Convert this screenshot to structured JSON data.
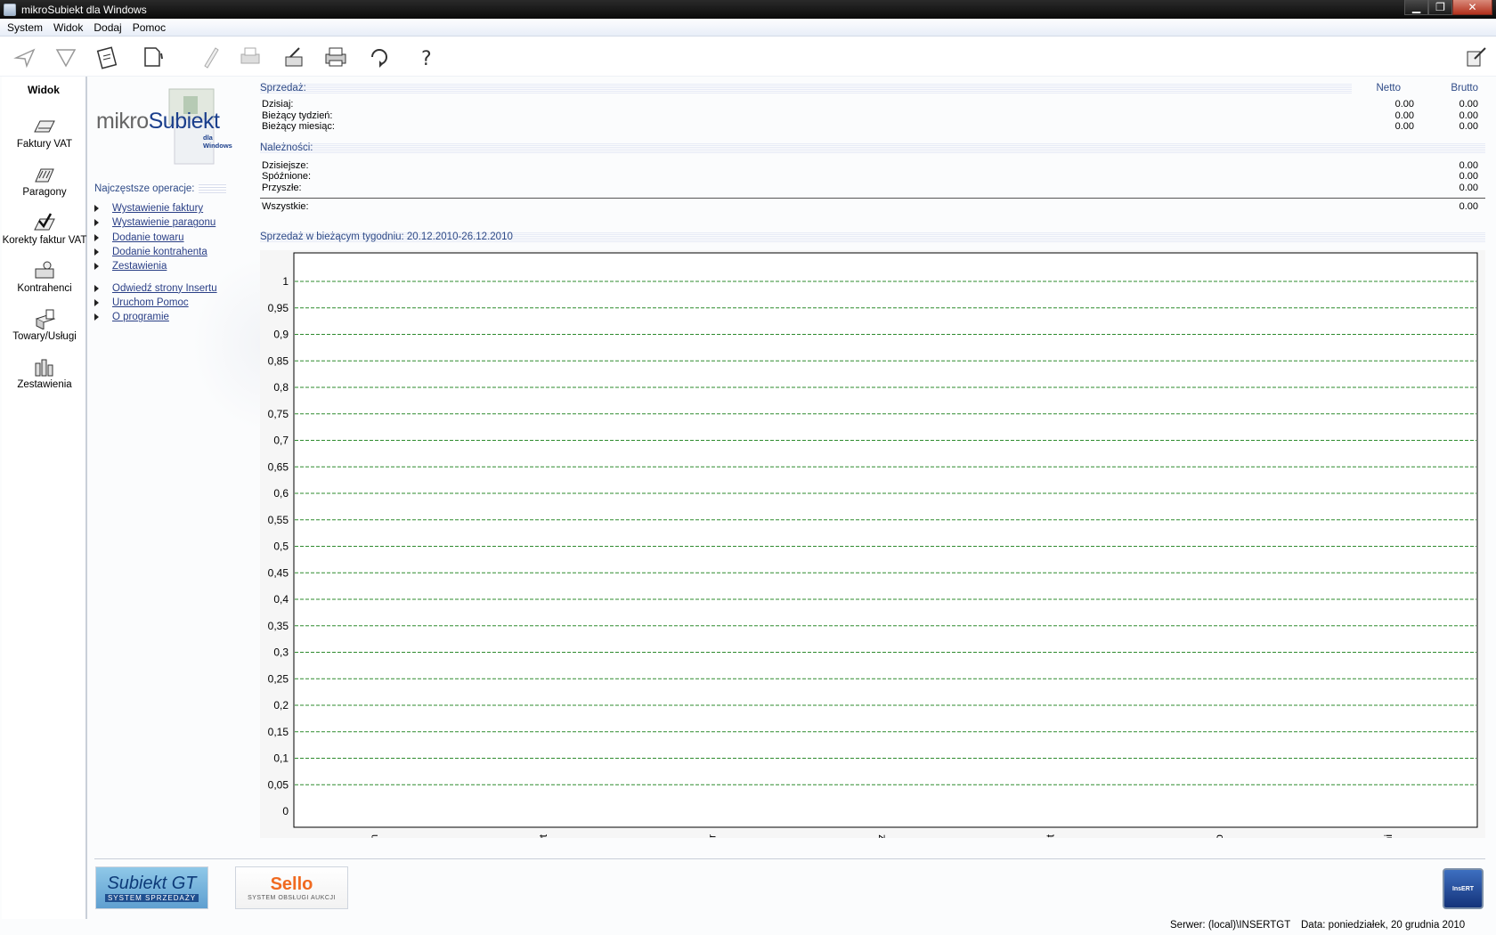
{
  "window": {
    "title": "mikroSubiekt dla Windows"
  },
  "menu": [
    "System",
    "Widok",
    "Dodaj",
    "Pomoc"
  ],
  "sidebar": {
    "title": "Widok",
    "items": [
      {
        "label": "Faktury VAT",
        "icon": "invoice-icon"
      },
      {
        "label": "Paragony",
        "icon": "receipt-icon"
      },
      {
        "label": "Korekty faktur VAT",
        "icon": "correction-icon"
      },
      {
        "label": "Kontrahenci",
        "icon": "contractors-icon"
      },
      {
        "label": "Towary/Usługi",
        "icon": "goods-icon"
      },
      {
        "label": "Zestawienia",
        "icon": "reports-icon"
      }
    ]
  },
  "logo": {
    "prefix": "mikro",
    "name": "Subiekt",
    "sub": "dla Windows"
  },
  "operations": {
    "header": "Najczęstsze operacje:",
    "group1": [
      "Wystawienie faktury",
      "Wystawienie paragonu",
      "Dodanie towaru",
      "Dodanie kontrahenta",
      "Zestawienia"
    ],
    "group2": [
      "Odwiedź strony Insertu",
      "Uruchom Pomoc",
      "O programie"
    ]
  },
  "sales": {
    "header": "Sprzedaż:",
    "netto_label": "Netto",
    "brutto_label": "Brutto",
    "rows": [
      {
        "label": "Dzisiaj:",
        "netto": "0.00",
        "brutto": "0.00"
      },
      {
        "label": "Bieżący tydzień:",
        "netto": "0.00",
        "brutto": "0.00"
      },
      {
        "label": "Bieżący miesiąc:",
        "netto": "0.00",
        "brutto": "0.00"
      }
    ]
  },
  "receivables": {
    "header": "Należności:",
    "rows": [
      {
        "label": "Dzisiejsze:",
        "value": "0.00"
      },
      {
        "label": "Spóźnione:",
        "value": "0.00"
      },
      {
        "label": "Przyszłe:",
        "value": "0.00"
      }
    ],
    "total": {
      "label": "Wszystkie:",
      "value": "0.00"
    }
  },
  "chart_data": {
    "type": "bar",
    "title": "Sprzedaż w bieżącym tygodniu: 20.12.2010-26.12.2010",
    "categories": [
      "pn",
      "wt",
      "śr",
      "cz",
      "pt",
      "so",
      "ni"
    ],
    "values": [
      0,
      0,
      0,
      0,
      0,
      0,
      0
    ],
    "ylim": [
      0,
      1
    ],
    "yticks": [
      "0",
      "0,05",
      "0,1",
      "0,15",
      "0,2",
      "0,25",
      "0,3",
      "0,35",
      "0,4",
      "0,45",
      "0,5",
      "0,55",
      "0,6",
      "0,65",
      "0,7",
      "0,75",
      "0,8",
      "0,85",
      "0,9",
      "0,95",
      "1"
    ],
    "grid": true,
    "gridColor": "#2e8b2e"
  },
  "badges": {
    "gt": {
      "big": "Subiekt GT",
      "small": "SYSTEM SPRZEDAŻY"
    },
    "sello": {
      "big": "Sello",
      "small": "SYSTEM OBSŁUGI AUKCJI"
    },
    "insert": "InsERT"
  },
  "status": {
    "server": "Serwer: (local)\\INSERTGT",
    "date": "Data: poniedziałek, 20 grudnia 2010"
  }
}
